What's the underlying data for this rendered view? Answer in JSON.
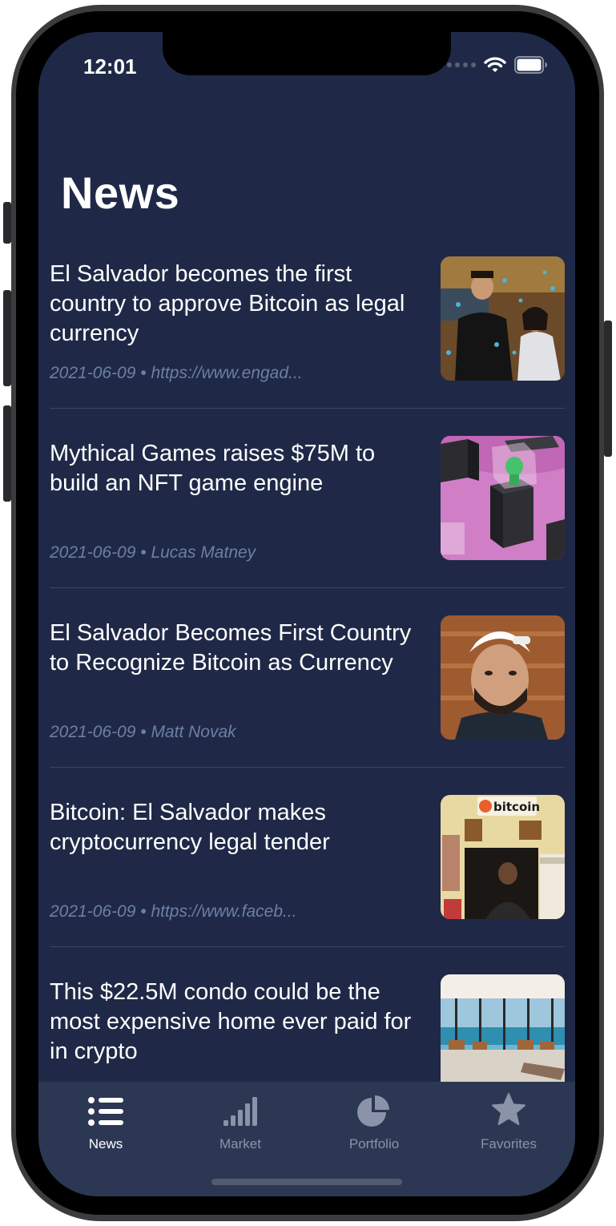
{
  "status_bar": {
    "time": "12:01"
  },
  "page": {
    "title": "News"
  },
  "articles": [
    {
      "headline": "El Salvador becomes the first country to approve Bitcoin as legal currency",
      "meta": "2021-06-09 • https://www.engad...",
      "image": "crowd-celebration-photo"
    },
    {
      "headline": "Mythical Games raises $75M to build an NFT game engine",
      "meta": "2021-06-09 • Lucas Matney",
      "image": "nft-toy-boxes-photo"
    },
    {
      "headline": "El Salvador Becomes First Country to Recognize Bitcoin as Currency",
      "meta": "2021-06-09 • Matt Novak",
      "image": "man-in-white-cap-photo"
    },
    {
      "headline": "Bitcoin: El Salvador makes cryptocurrency legal tender",
      "meta": "2021-06-09 • https://www.faceb...",
      "image": "bitcoin-shop-photo"
    },
    {
      "headline": "This $22.5M condo could be the most expensive home ever paid for in crypto",
      "meta": "",
      "image": "oceanview-condo-photo"
    }
  ],
  "tab_bar": {
    "tabs": [
      {
        "label": "News",
        "icon": "list-icon",
        "active": true
      },
      {
        "label": "Market",
        "icon": "bar-chart-icon",
        "active": false
      },
      {
        "label": "Portfolio",
        "icon": "pie-chart-icon",
        "active": false
      },
      {
        "label": "Favorites",
        "icon": "star-icon",
        "active": false
      }
    ]
  },
  "colors": {
    "background": "#1f2947",
    "tab_bar": "#2b3753",
    "meta_text": "#6c7fa6",
    "inactive_tab": "#8a93a8"
  }
}
